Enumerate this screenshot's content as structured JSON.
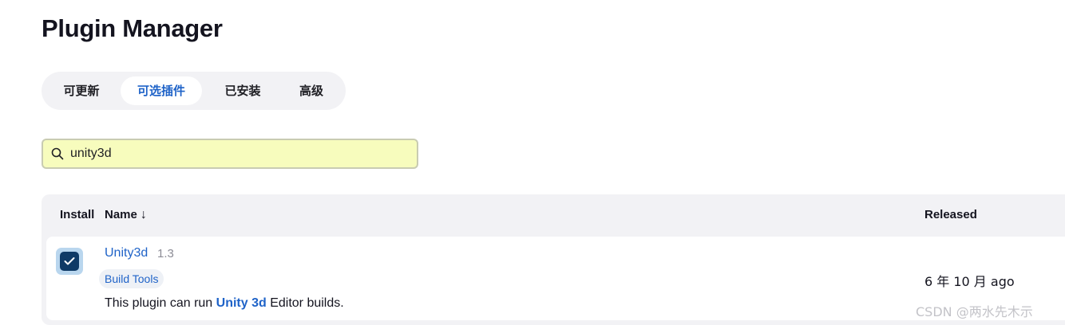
{
  "page": {
    "title": "Plugin Manager"
  },
  "tabs": [
    {
      "label": "可更新",
      "active": false
    },
    {
      "label": "可选插件",
      "active": true
    },
    {
      "label": "已安装",
      "active": false
    },
    {
      "label": "高级",
      "active": false
    }
  ],
  "search": {
    "value": "unity3d",
    "icon": "search-icon"
  },
  "table": {
    "columns": {
      "install": "Install",
      "name": "Name",
      "name_sort": "↓",
      "released": "Released"
    },
    "rows": [
      {
        "checked": true,
        "name": "Unity3d",
        "version": "1.3",
        "tag": "Build Tools",
        "desc_prefix": "This plugin can run ",
        "desc_highlight": "Unity 3d",
        "desc_suffix": " Editor builds.",
        "released": "6 年 10 月 ago"
      }
    ]
  },
  "watermark": "CSDN @两水先木示",
  "colors": {
    "accent": "#1f63c8",
    "search_bg": "#f7fcbd",
    "checkbox": "#0f3a66",
    "panel_bg": "#f2f2f5"
  }
}
